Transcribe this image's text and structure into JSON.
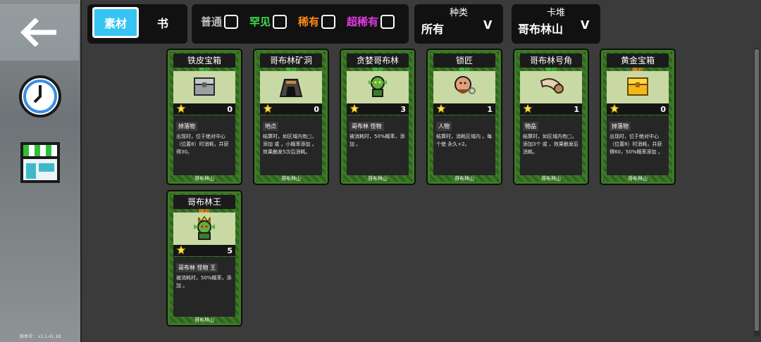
{
  "sidebar": {
    "back_icon": "arrow-left-icon",
    "history_icon": "clock-icon",
    "shop_icon": "shop-icon",
    "version": "版本号： v1.1.41.18"
  },
  "tabs": {
    "material": "素材",
    "book": "书"
  },
  "rarity_filters": [
    {
      "label": "普通",
      "color": "#bdbdbd"
    },
    {
      "label": "罕见",
      "color": "#3ee04a"
    },
    {
      "label": "稀有",
      "color": "#ff8a1a"
    },
    {
      "label": "超稀有",
      "color": "#e43ae6"
    }
  ],
  "type_dropdown": {
    "label": "种类",
    "value": "所有"
  },
  "deck_dropdown": {
    "label": "卡堆",
    "value": "哥布林山"
  },
  "cards": [
    {
      "title": "铁皮宝箱",
      "rarity": "罕见",
      "rarity_color": "#3ee04a",
      "count": "0",
      "tags": "掉落物",
      "desc": "出现时，位于绝对中心（位置8）时消耗，并获得30。",
      "deck": "哥布林山",
      "icon": "iron-chest-icon"
    },
    {
      "title": "哥布林矿洞",
      "rarity": "罕见",
      "rarity_color": "#3ee04a",
      "count": "0",
      "tags": "地点",
      "desc": "结算时，如区域内有□，添加 或 ，小概率添加 。效果触发5次后消耗。",
      "deck": "哥布林山",
      "icon": "goblin-mine-icon"
    },
    {
      "title": "贪婪哥布林",
      "rarity": "罕见",
      "rarity_color": "#3ee04a",
      "count": "3",
      "tags": "哥布林 怪物",
      "desc": "被消耗时，50%概率，添加 。",
      "deck": "哥布林山",
      "icon": "greedy-goblin-icon"
    },
    {
      "title": "锁匠",
      "rarity": "罕见",
      "rarity_color": "#3ee04a",
      "count": "1",
      "tags": "人物",
      "desc": "结算时，消耗区域内 。每个使 永久+2。",
      "deck": "哥布林山",
      "icon": "locksmith-icon"
    },
    {
      "title": "哥布林号角",
      "rarity": "罕见",
      "rarity_color": "#3ee04a",
      "count": "1",
      "tags": "物品",
      "desc": "结算时，如区域内有□，添加3个 或 ，效果触发后消耗。",
      "deck": "哥布林山",
      "icon": "goblin-horn-icon"
    },
    {
      "title": "黄金宝箱",
      "rarity": "稀有",
      "rarity_color": "#ff8a1a",
      "count": "0",
      "tags": "掉落物",
      "desc": "出现时，位于绝对中心（位置8）时消耗，并获得60，50%概率添加 。",
      "deck": "哥布林山",
      "icon": "gold-chest-icon"
    },
    {
      "title": "哥布林王",
      "rarity": "稀有",
      "rarity_color": "#ff8a1a",
      "count": "5",
      "tags": "哥布林 怪物 王",
      "desc": "被消耗时，50%概率，添加 。",
      "deck": "哥布林山",
      "icon": "goblin-king-icon"
    }
  ]
}
